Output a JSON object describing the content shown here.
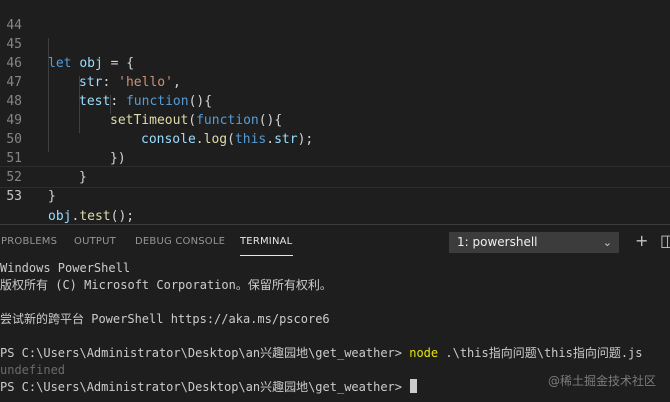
{
  "editor": {
    "lines": [
      {
        "no": "44"
      },
      {
        "no": "45",
        "p1": "let",
        "p2": " ",
        "p3": "obj",
        "p4": " = {"
      },
      {
        "no": "46",
        "p1": "str",
        "p2": ": ",
        "p3": "'hello'",
        "p4": ","
      },
      {
        "no": "47",
        "p1": "test",
        "p2": ": ",
        "p3": "function",
        "p4": "(){"
      },
      {
        "no": "48",
        "p1": "setTimeout",
        "p2": "(",
        "p3": "function",
        "p4": "(){"
      },
      {
        "no": "49",
        "p1": "console",
        "p2": ".",
        "p3": "log",
        "p4": "(",
        "p5": "this",
        "p6": ".",
        "p7": "str",
        "p8": ");"
      },
      {
        "no": "50",
        "p1": "})"
      },
      {
        "no": "51",
        "p1": "}"
      },
      {
        "no": "52",
        "p1": "}"
      },
      {
        "no": "53",
        "p1": "obj",
        "p2": ".",
        "p3": "test",
        "p4": "();"
      }
    ]
  },
  "panel": {
    "tabs": [
      "PROBLEMS",
      "OUTPUT",
      "DEBUG CONSOLE",
      "TERMINAL"
    ],
    "active_tab": "TERMINAL",
    "terminal_select": "1: powershell",
    "icons": {
      "add": "plus-icon",
      "split": "split-terminal-icon"
    }
  },
  "terminal": {
    "line1": "Windows PowerShell",
    "line2": "版权所有 (C) Microsoft Corporation。保留所有权利。",
    "line3": "尝试新的跨平台 PowerShell https://aka.ms/pscore6",
    "line4_prompt": "PS C:\\Users\\Administrator\\Desktop\\an兴趣园地\\get_weather> ",
    "line4_cmd": "node",
    "line4_args": " .\\this指向问题\\this指向问题.js",
    "line5": "undefined",
    "line6_prompt": "PS C:\\Users\\Administrator\\Desktop\\an兴趣园地\\get_weather> "
  },
  "watermark": "@稀土掘金技术社区"
}
